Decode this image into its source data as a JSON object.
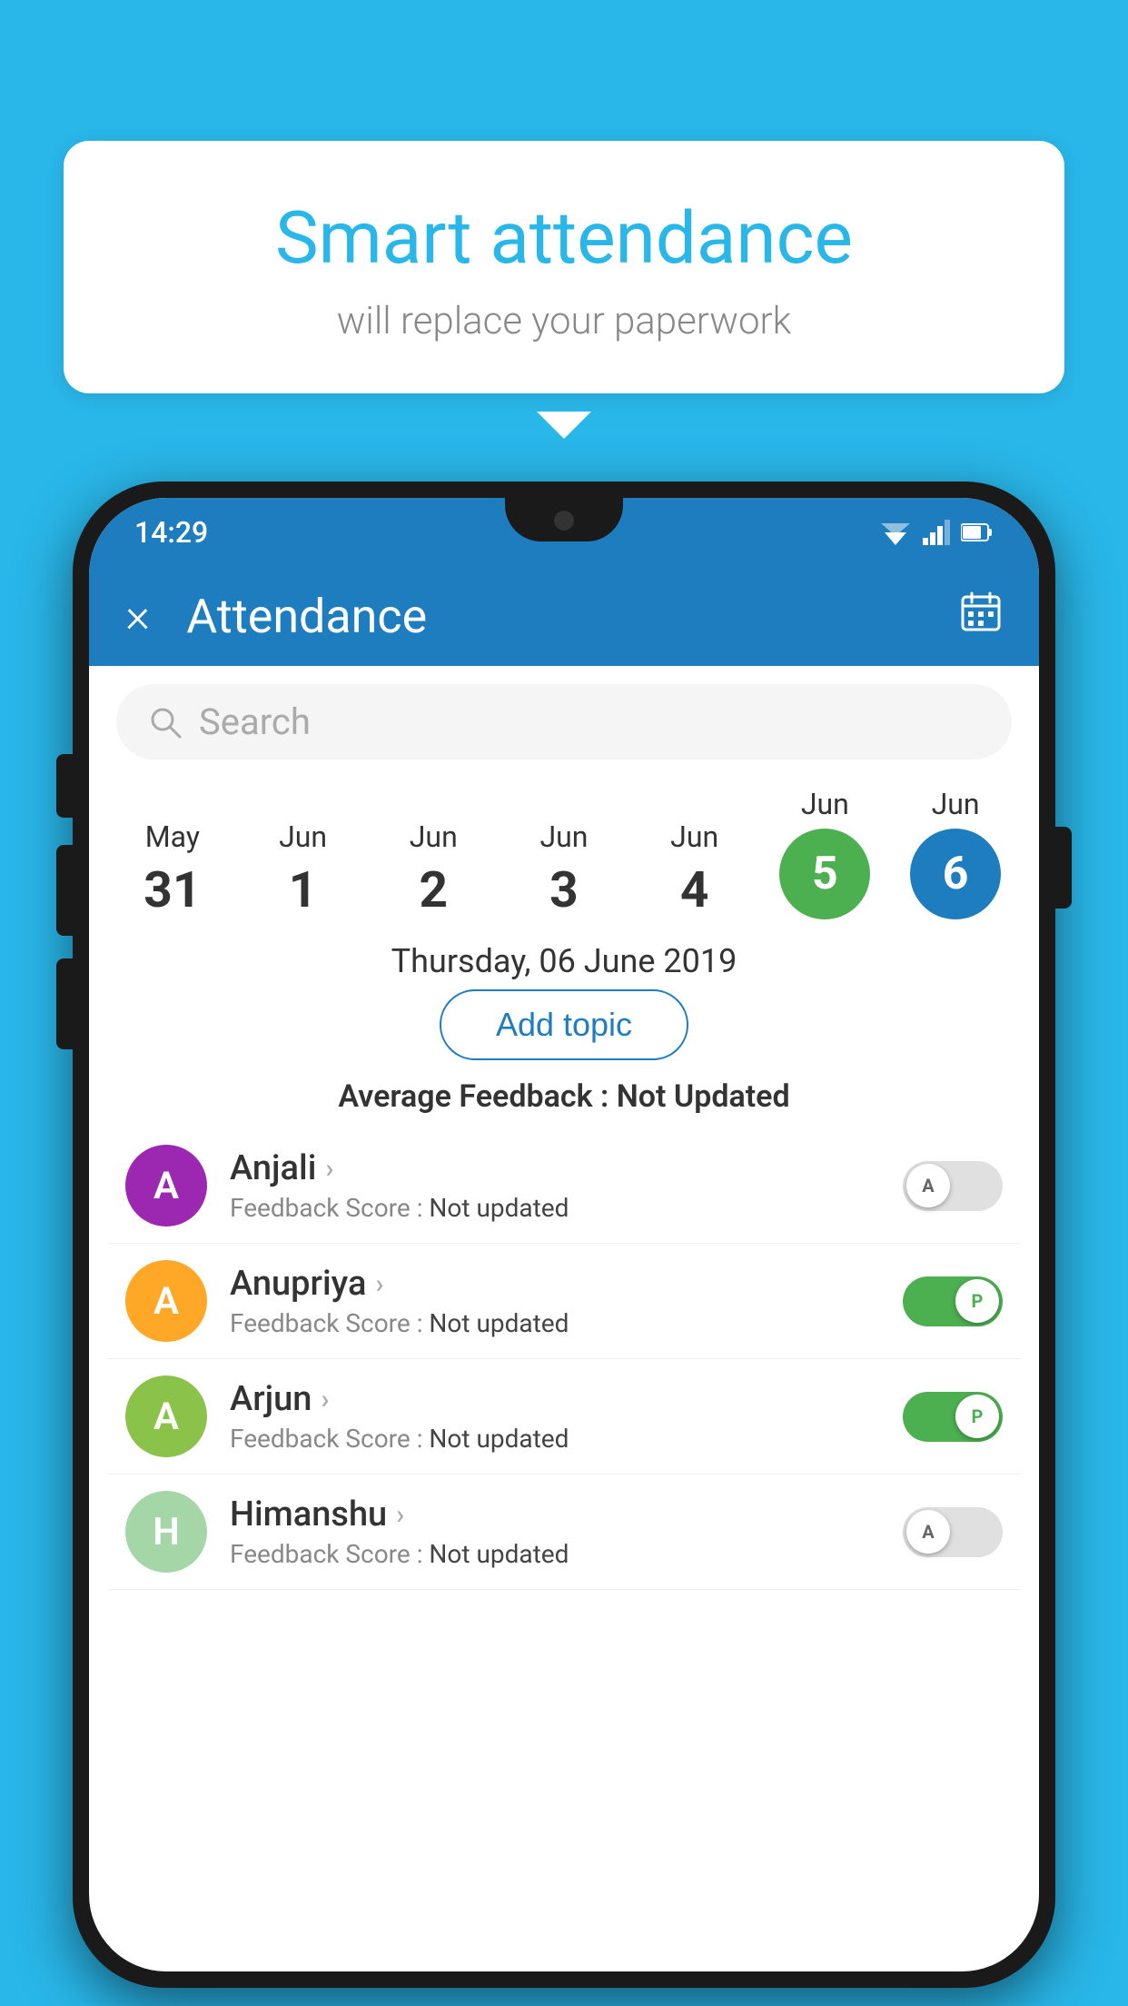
{
  "background_color": "#29b6e8",
  "bubble": {
    "title": "Smart attendance",
    "subtitle": "will replace your paperwork"
  },
  "app": {
    "status_time": "14:29",
    "app_bar_title": "Attendance",
    "close_label": "×",
    "search_placeholder": "Search",
    "selected_date_label": "Thursday, 06 June 2019",
    "add_topic_label": "Add topic",
    "avg_feedback_label": "Average Feedback : ",
    "avg_feedback_value": "Not Updated"
  },
  "calendar": [
    {
      "month": "May",
      "day": "31",
      "state": "normal"
    },
    {
      "month": "Jun",
      "day": "1",
      "state": "normal"
    },
    {
      "month": "Jun",
      "day": "2",
      "state": "normal"
    },
    {
      "month": "Jun",
      "day": "3",
      "state": "normal"
    },
    {
      "month": "Jun",
      "day": "4",
      "state": "normal"
    },
    {
      "month": "Jun",
      "day": "5",
      "state": "today"
    },
    {
      "month": "Jun",
      "day": "6",
      "state": "selected"
    }
  ],
  "students": [
    {
      "name": "Anjali",
      "avatar_letter": "A",
      "avatar_color": "#9c27b0",
      "feedback": "Not updated",
      "toggle_state": "off",
      "toggle_label": "A"
    },
    {
      "name": "Anupriya",
      "avatar_letter": "A",
      "avatar_color": "#ffa726",
      "feedback": "Not updated",
      "toggle_state": "on",
      "toggle_label": "P"
    },
    {
      "name": "Arjun",
      "avatar_letter": "A",
      "avatar_color": "#8bc34a",
      "feedback": "Not updated",
      "toggle_state": "on",
      "toggle_label": "P"
    },
    {
      "name": "Himanshu",
      "avatar_letter": "H",
      "avatar_color": "#a5d6a7",
      "feedback": "Not updated",
      "toggle_state": "off",
      "toggle_label": "A"
    }
  ]
}
